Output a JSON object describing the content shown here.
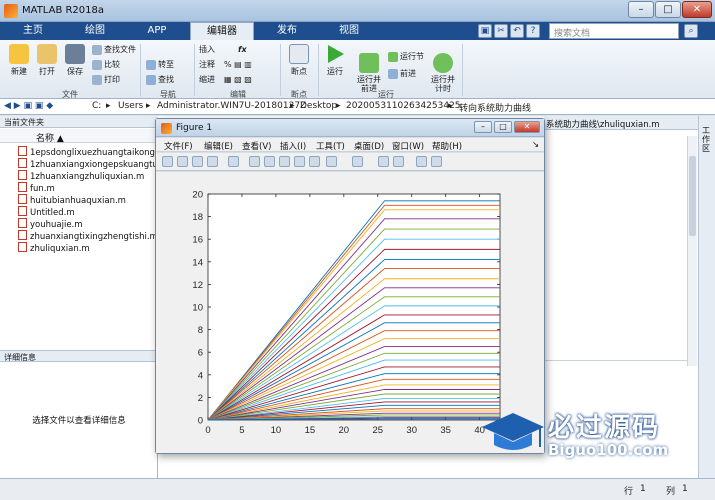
{
  "window": {
    "title": "MATLAB R2018a"
  },
  "tabs": [
    {
      "label": "主页"
    },
    {
      "label": "绘图"
    },
    {
      "label": "APP"
    },
    {
      "label": "编辑器"
    },
    {
      "label": "发布"
    },
    {
      "label": "视图"
    }
  ],
  "search": {
    "placeholder": "搜索文档"
  },
  "ribbon": {
    "file": {
      "new": "新建",
      "open": "打开",
      "save": "保存",
      "find_files": "查找文件",
      "compare": "比较",
      "print": "打印",
      "group": "文件"
    },
    "nav": {
      "goto": "转至",
      "find": "查找",
      "group": "导航"
    },
    "edit": {
      "insert": "插入",
      "comment": "注释",
      "indent": "缩进",
      "fx": "fx",
      "group": "编辑"
    },
    "breakpoints": {
      "label": "断点",
      "group": "断点"
    },
    "run": {
      "run": "运行",
      "run_advance": "运行并\n前进",
      "run_section": "运行节",
      "advance": "前进",
      "run_time": "运行并\n计时",
      "group": "运行"
    }
  },
  "address": {
    "parts": [
      "C:",
      "Users",
      "Administrator.WIN7U-20180127Z",
      "Desktop",
      "20200531102634253425",
      "转向系统助力曲线"
    ]
  },
  "left_panel": {
    "header": "当前文件夹",
    "column": "名称 ▲",
    "files": [
      "1epsdonglixuezhuangtaikongjian",
      "1zhuanxiangxiongepskuangtu.slx",
      "1zhuanxiangzhuliquxian.m",
      "fun.m",
      "huitubianhuaquxian.m",
      "Untitled.m",
      "youhuajie.m",
      "zhuanxiangtixingzhengtishi.m",
      "zhuliquxian.m"
    ],
    "detail_header": "详细信息",
    "detail_message": "选择文件以查看详细信息"
  },
  "editor": {
    "tab": "系统助力曲线\\zhuliquxian.m"
  },
  "sidebar": {
    "label": "工作区"
  },
  "status": {
    "row_label": "行",
    "row": "1",
    "col_label": "列",
    "col": "1"
  },
  "figure": {
    "title": "Figure 1",
    "menu": [
      "文件(F)",
      "编辑(E)",
      "查看(V)",
      "插入(I)",
      "工具(T)",
      "桌面(D)",
      "窗口(W)",
      "帮助(H)"
    ]
  },
  "watermark": {
    "cn": "必过源码",
    "en": "Biguo100.com"
  },
  "colors": {
    "ribbon_blue": "#1f4e8f",
    "accent": "#e85a16"
  },
  "chart_data": {
    "type": "line",
    "xlim": [
      0,
      43
    ],
    "ylim": [
      0,
      20
    ],
    "xticks": [
      0,
      5,
      10,
      15,
      20,
      25,
      30,
      35,
      40
    ],
    "yticks": [
      0,
      2,
      4,
      6,
      8,
      10,
      12,
      14,
      16,
      18,
      20
    ],
    "knee_x": 26,
    "x_end": 43,
    "grid": false,
    "title": "",
    "xlabel": "",
    "ylabel": "",
    "plateaus": [
      19.4,
      19.0,
      18.6,
      17.8,
      16.9,
      16.0,
      15.1,
      14.2,
      13.4,
      12.5,
      11.7,
      10.9,
      10.1,
      9.3,
      8.6,
      7.9,
      7.2,
      6.5,
      5.9,
      5.3,
      4.7,
      4.1,
      3.6,
      3.1,
      2.7,
      2.3,
      1.9,
      1.6,
      1.3,
      1.0,
      0.8,
      0.6,
      0.45,
      0.3,
      0.2,
      0.1
    ],
    "series_colors": [
      "#0072bd",
      "#d95319",
      "#edb120",
      "#7e2f8e",
      "#77ac30",
      "#4dbeee",
      "#a2142f"
    ]
  }
}
